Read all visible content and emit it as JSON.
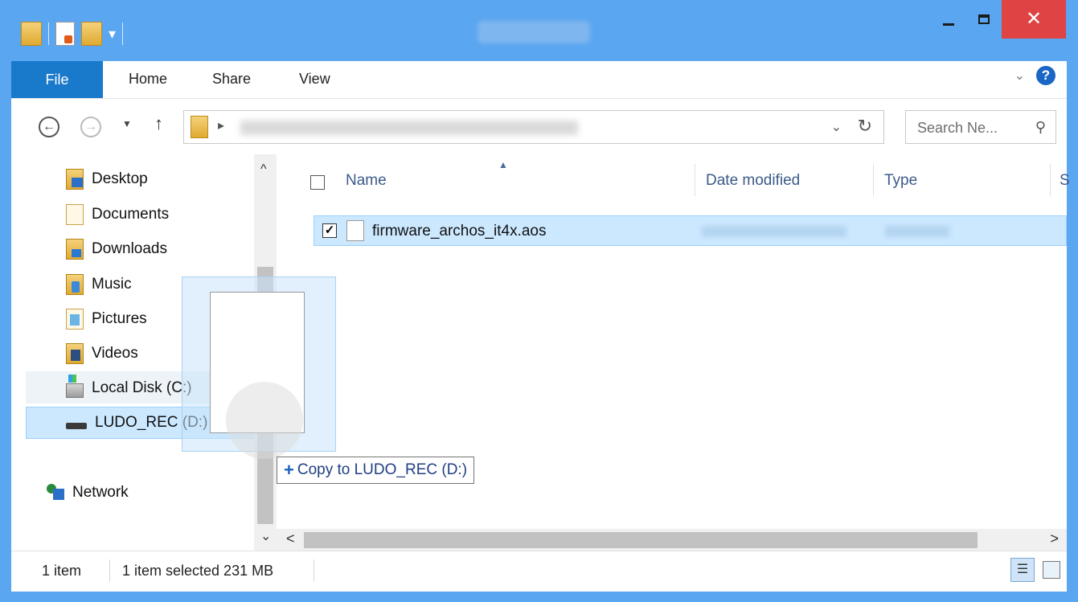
{
  "ribbon": {
    "file": "File",
    "home": "Home",
    "share": "Share",
    "view": "View"
  },
  "search": {
    "placeholder": "Search Ne..."
  },
  "nav": {
    "items": [
      {
        "label": "Desktop"
      },
      {
        "label": "Documents"
      },
      {
        "label": "Downloads"
      },
      {
        "label": "Music"
      },
      {
        "label": "Pictures"
      },
      {
        "label": "Videos"
      },
      {
        "label": "Local Disk (C:)"
      },
      {
        "label": "LUDO_REC (D:)"
      }
    ],
    "network": "Network"
  },
  "columns": {
    "name": "Name",
    "date": "Date modified",
    "type": "Type",
    "size": "S"
  },
  "files": [
    {
      "name": "firmware_archos_it4x.aos",
      "checked": true
    }
  ],
  "drag": {
    "tooltip": "Copy to LUDO_REC (D:)"
  },
  "status": {
    "count": "1 item",
    "selected": "1 item selected  231 MB"
  },
  "colors": {
    "titlebar": "#5aa6f0",
    "file_tab": "#1979ca",
    "close": "#e04343",
    "selection": "#cce8ff"
  },
  "icons": {
    "back": "back-arrow-icon",
    "forward": "forward-arrow-icon",
    "up": "up-arrow-icon",
    "refresh": "refresh-icon",
    "search": "search-icon",
    "help": "help-icon"
  }
}
